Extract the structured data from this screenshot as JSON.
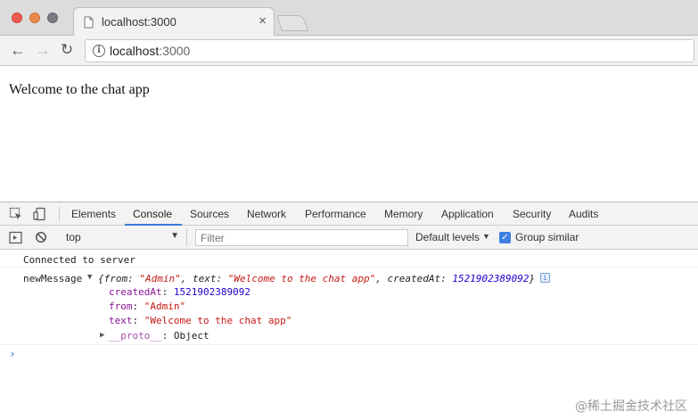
{
  "browser": {
    "tab_title": "localhost:3000",
    "tab_close": "×",
    "url_host": "localhost",
    "url_port": ":3000"
  },
  "page": {
    "text": "Welcome to the chat app"
  },
  "devtools": {
    "tabs": [
      "Elements",
      "Console",
      "Sources",
      "Network",
      "Performance",
      "Memory",
      "Application",
      "Security",
      "Audits"
    ],
    "active_tab": "Console",
    "context": "top",
    "filter_placeholder": "Filter",
    "levels_label": "Default levels",
    "group_similar_label": "Group similar",
    "group_similar_checked": true
  },
  "console": {
    "line1": "Connected to server",
    "line2_label": "newMessage",
    "preview": {
      "open": "{",
      "from_key": "from: ",
      "from_val": "\"Admin\"",
      "text_key": ", text: ",
      "text_val": "\"Welcome to the chat app\"",
      "created_key": ", createdAt: ",
      "created_val": "1521902389092",
      "close": "}"
    },
    "props": [
      {
        "key": "createdAt",
        "sep": ": ",
        "value": "1521902389092",
        "kind": "num"
      },
      {
        "key": "from",
        "sep": ": ",
        "value": "\"Admin\"",
        "kind": "str"
      },
      {
        "key": "text",
        "sep": ": ",
        "value": "\"Welcome to the chat app\"",
        "kind": "str"
      }
    ],
    "proto_key": "__proto__",
    "proto_val": ": Object",
    "prompt": "›"
  },
  "watermark": "@稀土掘金技术社区",
  "colors": {
    "accent": "#3879d9",
    "string": "#c41a16",
    "number": "#1c00cf",
    "key": "#881391"
  }
}
